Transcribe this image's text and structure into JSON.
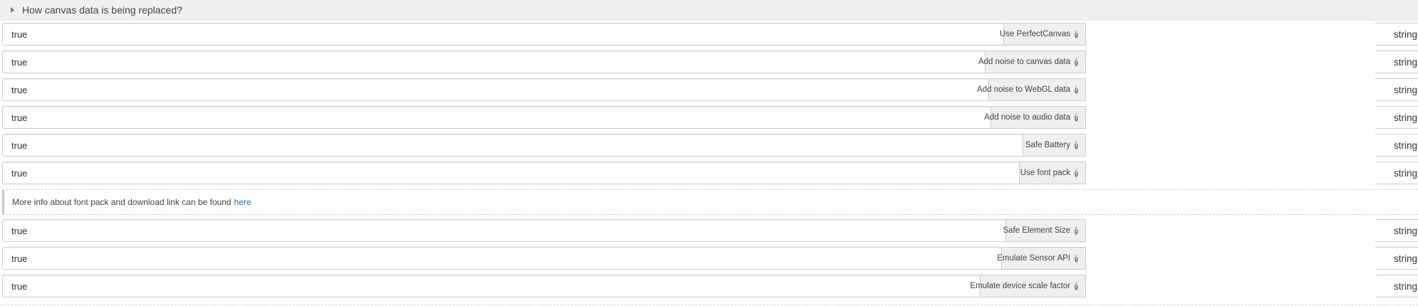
{
  "section": {
    "title": "How canvas data is being replaced?"
  },
  "rows_before_info": [
    {
      "value": "true",
      "label": "Use PerfectCanvas",
      "type": "string"
    },
    {
      "value": "true",
      "label": "Add noise to canvas data",
      "type": "string"
    },
    {
      "value": "true",
      "label": "Add noise to WebGL data",
      "type": "string"
    },
    {
      "value": "true",
      "label": "Add noise to audio data",
      "type": "string"
    },
    {
      "value": "true",
      "label": "Safe Battery",
      "type": "string"
    },
    {
      "value": "true",
      "label": "Use font pack",
      "type": "string"
    }
  ],
  "info": {
    "text": "More info about font pack and download link can be found",
    "link_text": "here"
  },
  "rows_after_info": [
    {
      "value": "true",
      "label": "Safe Element Size",
      "type": "string"
    },
    {
      "value": "true",
      "label": "Emulate Sensor API",
      "type": "string"
    },
    {
      "value": "true",
      "label": "Emulate device scale factor",
      "type": "string"
    }
  ],
  "help_glyph": "?",
  "colors": {
    "link": "#2a6aa8",
    "header_bg": "#f0f0f0",
    "label_bg": "#efefef"
  }
}
